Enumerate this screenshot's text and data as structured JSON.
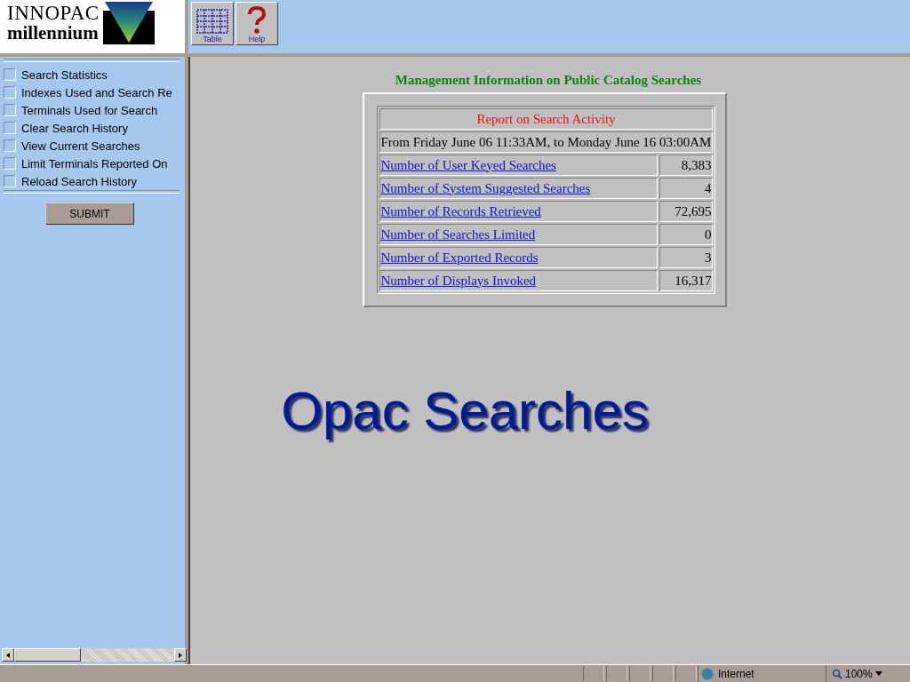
{
  "logo": {
    "line1": "INNOPAC",
    "line2": "millennium"
  },
  "toolbar": [
    {
      "kind": "table",
      "label": "Table"
    },
    {
      "kind": "help",
      "label": "Help"
    }
  ],
  "sidebar": {
    "items": [
      {
        "label": "Search Statistics",
        "checked": false
      },
      {
        "label": "Indexes Used and Search Re",
        "checked": false
      },
      {
        "label": "Terminals Used for Search",
        "checked": false
      },
      {
        "label": "Clear Search History",
        "checked": false
      },
      {
        "label": "View Current Searches",
        "checked": false
      },
      {
        "label": "Limit Terminals Reported On",
        "checked": false
      },
      {
        "label": "Reload Search History",
        "checked": false
      }
    ],
    "submit": "SUBMIT"
  },
  "report": {
    "heading": "Management Information on Public Catalog Searches",
    "title": "Report on Search Activity",
    "period": "From Friday June 06 11:33AM, to Monday June 16 03:00AM",
    "rows": [
      {
        "label": "Number of User Keyed Searches",
        "value": "8,383"
      },
      {
        "label": "Number of System Suggested Searches",
        "value": "4"
      },
      {
        "label": "Number of Records Retrieved",
        "value": "72,695"
      },
      {
        "label": "Number of Searches Limited",
        "value": "0"
      },
      {
        "label": "Number of Exported Records",
        "value": "3"
      },
      {
        "label": "Number of Displays Invoked",
        "value": "16,317"
      }
    ]
  },
  "slide_title": "Opac Searches",
  "status_bar": {
    "zone": "Internet",
    "zoom": "100%"
  }
}
